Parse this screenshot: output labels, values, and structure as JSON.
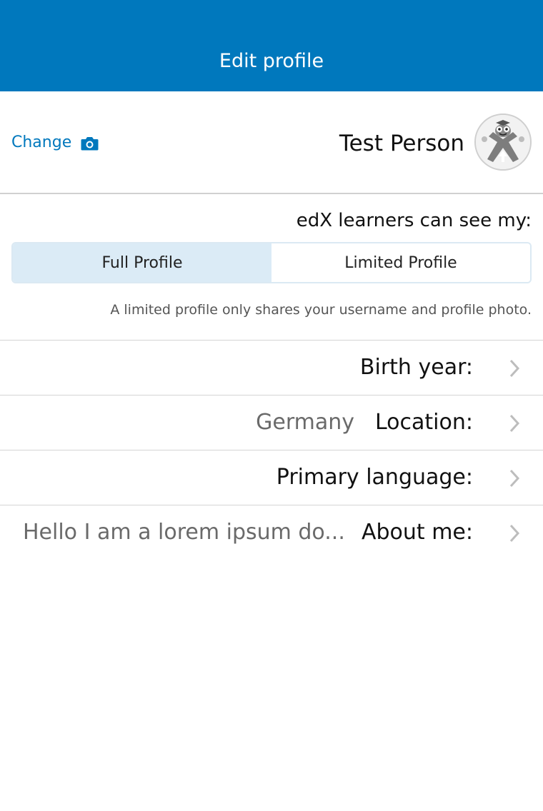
{
  "navbar": {
    "title": "Edit profile"
  },
  "header": {
    "change_label": "Change",
    "camera_icon": "camera-icon",
    "name": "Test Person",
    "avatar_icon": "avatar-icon"
  },
  "privacy": {
    "heading": "edX learners can see my:",
    "options": [
      {
        "label": "Full Profile",
        "selected": true
      },
      {
        "label": "Limited Profile",
        "selected": false
      }
    ],
    "note": "A limited profile only shares your username and profile photo."
  },
  "fields": [
    {
      "label": "Birth year:",
      "value": ""
    },
    {
      "label": "Location:",
      "value": "Germany"
    },
    {
      "label": "Primary language:",
      "value": ""
    },
    {
      "label": "About me:",
      "value": "Hello I am a lorem ipsum do..."
    }
  ],
  "colors": {
    "accent": "#0078bd",
    "segment_selected": "#dbebf6",
    "divider": "#d4d4d4"
  }
}
